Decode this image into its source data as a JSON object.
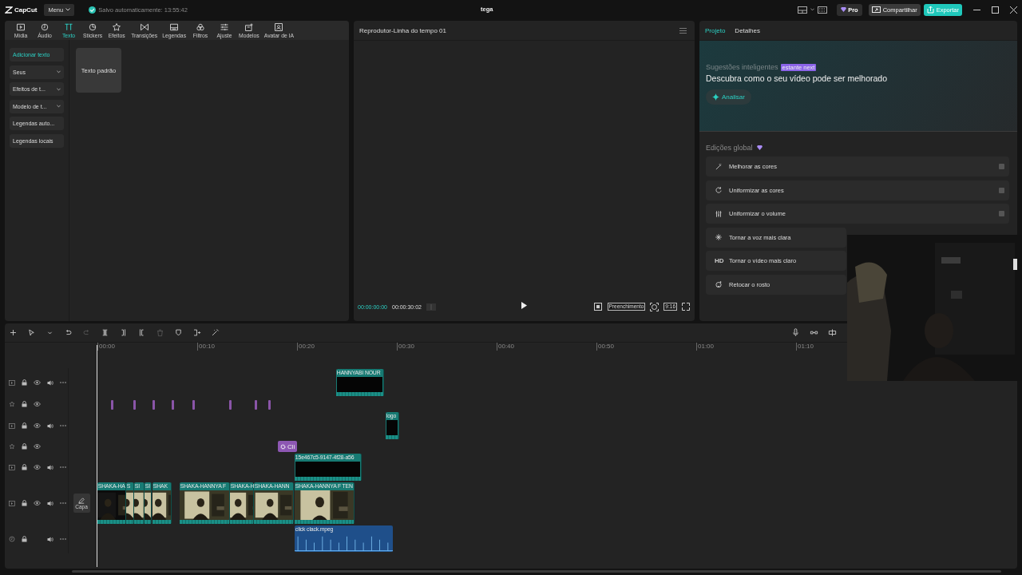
{
  "top_bar": {
    "logo": "CapCut",
    "menu": "Menu",
    "autosave": "Salvo automaticamente: 13:55:42",
    "project_title": "tega",
    "pro": "Pro",
    "share": "Compartilhar",
    "export": "Exportar"
  },
  "toolbar": {
    "tabs": [
      {
        "label": "Mídia",
        "selected": false
      },
      {
        "label": "Áudio",
        "selected": false
      },
      {
        "label": "Texto",
        "selected": true
      },
      {
        "label": "Stickers",
        "selected": false
      },
      {
        "label": "Efeitos",
        "selected": false
      },
      {
        "label": "Transições",
        "selected": false
      },
      {
        "label": "Legendas",
        "selected": false
      },
      {
        "label": "Filtros",
        "selected": false
      },
      {
        "label": "Ajuste",
        "selected": false
      },
      {
        "label": "Modelos",
        "selected": false
      },
      {
        "label": "Avatar de IA",
        "selected": false
      }
    ]
  },
  "text_panel": {
    "sidebar": [
      {
        "label": "Adicionar texto",
        "kind": "item",
        "selected": true
      },
      {
        "label": "Seus",
        "kind": "dropdown",
        "selected": false
      },
      {
        "label": "Efeitos de t...",
        "kind": "dropdown",
        "selected": false
      },
      {
        "label": "Modelo de t...",
        "kind": "dropdown",
        "selected": false
      },
      {
        "label": "Legendas auto...",
        "kind": "item",
        "selected": false
      },
      {
        "label": "Legendas locais",
        "kind": "item",
        "selected": false
      }
    ],
    "presets": [
      "Texto padrão"
    ]
  },
  "player": {
    "title": "Reprodutor-Linha do tempo 01",
    "current_time": "00:00:00:00",
    "duration": "00:00:30:02",
    "fit": "Preenchimento",
    "ratio": "9:16"
  },
  "inspector": {
    "tabs": [
      {
        "label": "Projeto",
        "selected": true
      },
      {
        "label": "Detalhes",
        "selected": false
      }
    ],
    "suggestions": {
      "title": "Sugestões inteligentes",
      "badge": "estante next",
      "headline": "Descubra como o seu vídeo pode ser melhorado",
      "button": "Analisar"
    },
    "global_edits": {
      "title": "Edições global",
      "items": [
        {
          "label": "Melhorar as cores",
          "checked": false
        },
        {
          "label": "Uniformizar as cores",
          "checked": false
        },
        {
          "label": "Uniformizar o volume",
          "checked": false
        },
        {
          "label": "Tornar a voz mais clara"
        },
        {
          "label": "Tornar o vídeo mais claro",
          "badge": "HD"
        },
        {
          "label": "Retocar o rosto"
        }
      ]
    }
  },
  "timeline": {
    "ruler": [
      "00:00",
      "00:10",
      "00:20",
      "00:30",
      "00:40",
      "00:50",
      "01:00",
      "01:10"
    ],
    "cover_button": "Capa",
    "tracks": [
      {
        "kind": "overlay",
        "clips": [
          {
            "label": "HANNYABI NOUR"
          }
        ]
      },
      {
        "kind": "marks"
      },
      {
        "kind": "overlay",
        "clips": [
          {
            "label": "logo"
          }
        ]
      },
      {
        "kind": "effect",
        "clips": [
          {
            "label": "Cli"
          }
        ]
      },
      {
        "kind": "overlay",
        "clips": [
          {
            "label": "15e467c5-9147-4f28-a56"
          }
        ]
      },
      {
        "kind": "main",
        "clips": [
          {
            "label": "SHAKA-HA"
          },
          {
            "label": "S"
          },
          {
            "label": "SI"
          },
          {
            "label": "SI"
          },
          {
            "label": "SHAK"
          },
          {
            "label": "SHAKA-HANNYA F"
          },
          {
            "label": "SHAKA-H"
          },
          {
            "label": "SHAKA-HANN"
          },
          {
            "label": "SHAKA-HANNYA F TEN"
          }
        ]
      },
      {
        "kind": "audio",
        "clips": [
          {
            "label": "click clack.mpeg"
          }
        ]
      }
    ]
  }
}
